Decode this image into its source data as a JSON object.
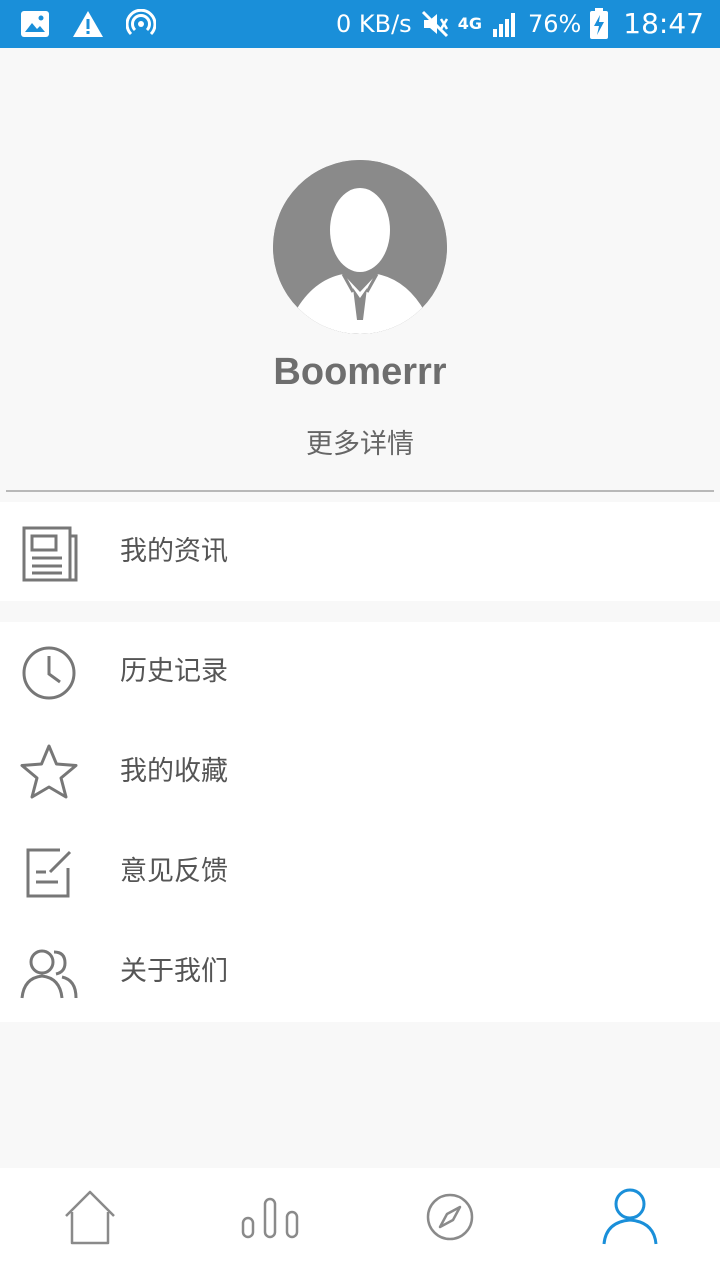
{
  "status_bar": {
    "network_speed": "0 KB/s",
    "network_type": "4G",
    "battery": "76%",
    "time": "18:47",
    "icons": [
      "image-icon",
      "warning-icon",
      "hotspot-icon",
      "mute-icon",
      "signal-icon",
      "battery-charging-icon"
    ]
  },
  "profile": {
    "username": "Boomerrr",
    "more_details": "更多详情"
  },
  "menu": {
    "group1": [
      {
        "label": "我的资讯",
        "icon": "news-icon"
      }
    ],
    "group2": [
      {
        "label": "历史记录",
        "icon": "clock-icon"
      },
      {
        "label": "我的收藏",
        "icon": "star-icon"
      },
      {
        "label": "意见反馈",
        "icon": "feedback-edit-icon"
      },
      {
        "label": "关于我们",
        "icon": "users-icon"
      }
    ]
  },
  "bottom_nav": {
    "items": [
      {
        "name": "home",
        "icon": "home-icon",
        "active": false
      },
      {
        "name": "stats",
        "icon": "bar-chart-icon",
        "active": false
      },
      {
        "name": "discover",
        "icon": "compass-icon",
        "active": false
      },
      {
        "name": "profile",
        "icon": "person-icon",
        "active": true
      }
    ],
    "active_color": "#1a8fd9",
    "inactive_color": "#8a8a8a"
  },
  "colors": {
    "status_bar": "#1a8fd9",
    "background": "#f8f8f8",
    "text": "#555555"
  }
}
